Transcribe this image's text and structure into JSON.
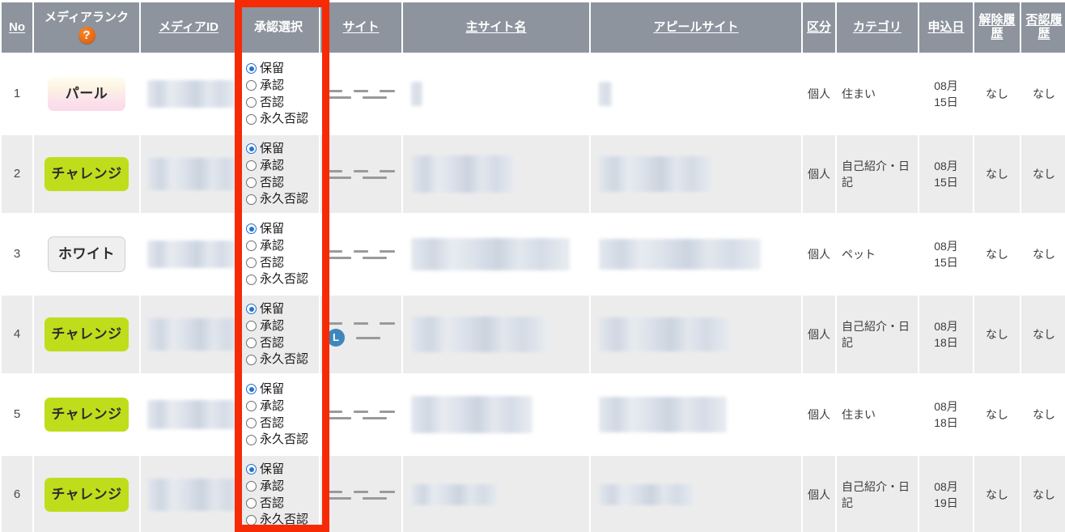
{
  "table": {
    "headers": [
      {
        "label": "No",
        "name": "no",
        "link": true
      },
      {
        "label": "メディアランク",
        "name": "media-rank",
        "link": false,
        "help": "?"
      },
      {
        "label": "メディアID",
        "name": "media-id",
        "link": true
      },
      {
        "label": "承認選択",
        "name": "approval-select",
        "link": false
      },
      {
        "label": "サイト",
        "name": "site",
        "link": true
      },
      {
        "label": "主サイト名",
        "name": "main-site-name",
        "link": true
      },
      {
        "label": "アピールサイト",
        "name": "appeal-site",
        "link": true
      },
      {
        "label": "区分",
        "name": "kubun",
        "link": true
      },
      {
        "label": "カテゴリ",
        "name": "category",
        "link": true
      },
      {
        "label": "申込日",
        "name": "application-date",
        "link": true
      },
      {
        "label": "解除履歴",
        "name": "release-history",
        "link": true
      },
      {
        "label": "否認履歴",
        "name": "denial-history",
        "link": true
      }
    ],
    "approval_options": [
      {
        "label": "保留",
        "value": "hold"
      },
      {
        "label": "承認",
        "value": "approve"
      },
      {
        "label": "否認",
        "value": "deny"
      },
      {
        "label": "永久否認",
        "value": "permanent-deny"
      }
    ],
    "rows": [
      {
        "no": "1",
        "rank": "パール",
        "rank_style": "pearl",
        "approval_selected": "保留",
        "site_dashes": [
          3,
          2
        ],
        "site_line_badge": false,
        "kubun": "個人",
        "category": "住まい",
        "date": "08月\n15日",
        "release_history": "なし",
        "denial_history": "なし"
      },
      {
        "no": "2",
        "rank": "チャレンジ",
        "rank_style": "challenge",
        "approval_selected": "保留",
        "site_dashes": [
          3,
          2
        ],
        "site_line_badge": false,
        "kubun": "個人",
        "category": "自己紹介・日記",
        "date": "08月\n15日",
        "release_history": "なし",
        "denial_history": "なし"
      },
      {
        "no": "3",
        "rank": "ホワイト",
        "rank_style": "white",
        "approval_selected": "保留",
        "site_dashes": [
          3,
          2
        ],
        "site_line_badge": false,
        "kubun": "個人",
        "category": "ペット",
        "date": "08月\n15日",
        "release_history": "なし",
        "denial_history": "なし"
      },
      {
        "no": "4",
        "rank": "チャレンジ",
        "rank_style": "challenge",
        "approval_selected": "保留",
        "site_dashes": [
          3,
          1
        ],
        "site_line_badge": true,
        "site_line_badge_label": "L",
        "kubun": "個人",
        "category": "自己紹介・日記",
        "date": "08月\n18日",
        "release_history": "なし",
        "denial_history": "なし"
      },
      {
        "no": "5",
        "rank": "チャレンジ",
        "rank_style": "challenge",
        "approval_selected": "保留",
        "site_dashes": [
          3,
          2
        ],
        "site_line_badge": false,
        "kubun": "個人",
        "category": "住まい",
        "date": "08月\n18日",
        "release_history": "なし",
        "denial_history": "なし"
      },
      {
        "no": "6",
        "rank": "チャレンジ",
        "rank_style": "challenge",
        "approval_selected": "保留",
        "site_dashes": [
          3,
          2
        ],
        "site_line_badge": false,
        "kubun": "個人",
        "category": "自己紹介・日記",
        "date": "08月\n19日",
        "release_history": "なし",
        "denial_history": "なし"
      }
    ]
  },
  "colors": {
    "header_bg": "#8d949e",
    "highlight_red": "#f62a05",
    "rank_challenge": "#c0dd1c",
    "radio_selected": "#1f73d8",
    "line_badge": "#3d87bd",
    "help_icon": "#ea6a12",
    "row_alt_bg": "#ececec"
  }
}
